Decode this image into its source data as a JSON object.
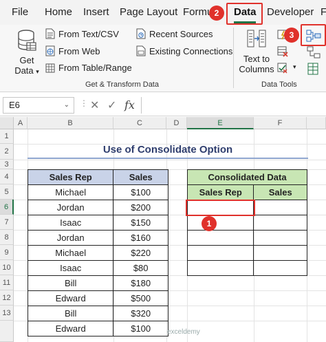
{
  "ribbon_tabs": [
    "File",
    "Home",
    "Insert",
    "Page Layout",
    "Formu",
    "Data",
    "Developer",
    "F"
  ],
  "active_tab": "Data",
  "badges": [
    "1",
    "2",
    "3"
  ],
  "get_transform": {
    "get_data": "Get",
    "get_data_line2": "Data",
    "from_text": "From Text/CSV",
    "from_web": "From Web",
    "from_table": "From Table/Range",
    "recent_sources": "Recent Sources",
    "existing_connections": "Existing Connections",
    "group_label": "Get & Transform Data"
  },
  "data_tools": {
    "text_to": "Text to",
    "columns": "Columns",
    "group_label": "Data Tools"
  },
  "formula_bar": {
    "name_box": "E6",
    "fx": "fx",
    "cancel": "✕",
    "enter": "✓"
  },
  "columns": [
    "A",
    "B",
    "C",
    "D",
    "E",
    "F"
  ],
  "rows": [
    "1",
    "2",
    "3",
    "4",
    "5",
    "6",
    "7",
    "8",
    "9",
    "10",
    "11",
    "12",
    "13"
  ],
  "selected_cell": {
    "column": "E",
    "row": "6"
  },
  "sheet_title": "Use of Consolidate Option",
  "sales_table": {
    "headers": [
      "Sales Rep",
      "Sales"
    ],
    "rows": [
      [
        "Michael",
        "$100"
      ],
      [
        "Jordan",
        "$200"
      ],
      [
        "Isaac",
        "$150"
      ],
      [
        "Jordan",
        "$160"
      ],
      [
        "Michael",
        "$220"
      ],
      [
        "Isaac",
        "$80"
      ],
      [
        "Bill",
        "$180"
      ],
      [
        "Edward",
        "$500"
      ],
      [
        "Bill",
        "$320"
      ],
      [
        "Edward",
        "$100"
      ]
    ]
  },
  "consolidated_table": {
    "title": "Consolidated Data",
    "headers": [
      "Sales Rep",
      "Sales"
    ]
  },
  "watermark": "exceldemy",
  "colors": {
    "accent": "#217346",
    "highlight": "#e0312b",
    "header_blue": "#c9d3e8",
    "header_green": "#c8e6b4"
  }
}
